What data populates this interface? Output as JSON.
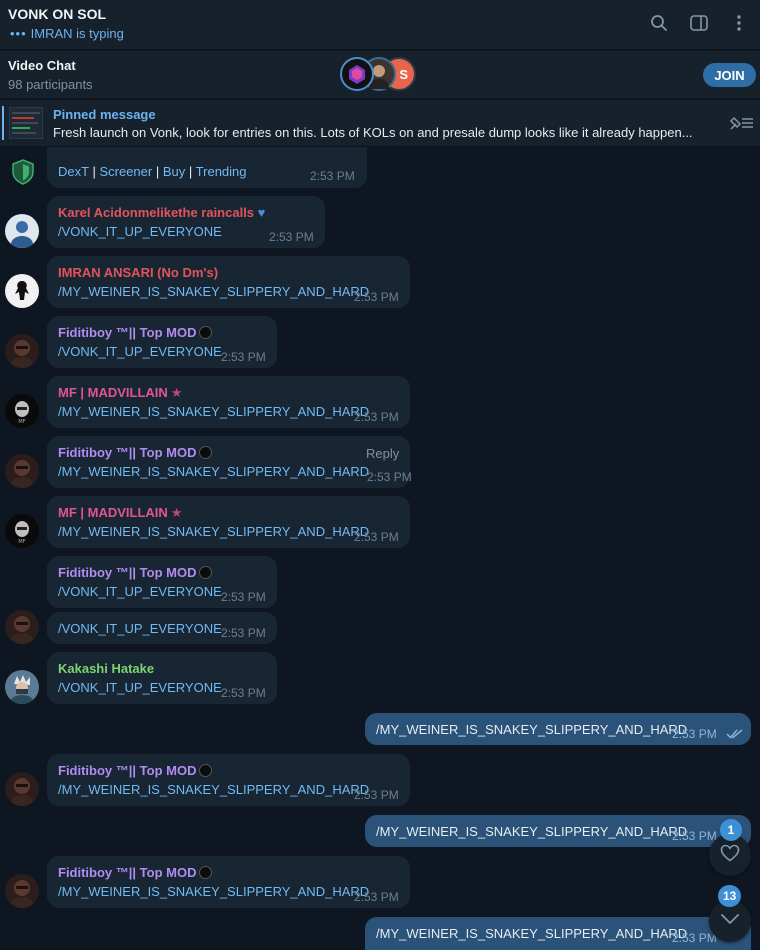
{
  "header": {
    "title": "VONK ON SOL",
    "typing": "IMRAN is typing",
    "typing_dots": "•••"
  },
  "video_chat": {
    "title": "Video Chat",
    "participants": "98 participants",
    "join_label": "JOIN",
    "third_avatar_letter": "S"
  },
  "pinned": {
    "title": "Pinned message",
    "text": "Fresh launch on Vonk, look for entries on this. Lots of KOLs on and presale dump looks like it already happen..."
  },
  "bot_links": {
    "dext": "DexT",
    "sep": "|",
    "screener": "Screener",
    "buy": "Buy",
    "trending": "Trending",
    "time": "2:53 PM"
  },
  "messages": [
    {
      "name": "Karel Acidonmelikethe raincalls",
      "text": "/VONK_IT_UP_EVERYONE",
      "time": "2:53 PM"
    },
    {
      "name": "IMRAN ANSARI (No Dm's)",
      "text": "/MY_WEINER_IS_SNAKEY_SLIPPERY_AND_HARD",
      "time": "2:53 PM"
    },
    {
      "name": "Fiditiboy ™|| Top MOD",
      "text": "/VONK_IT_UP_EVERYONE",
      "time": "2:53 PM"
    },
    {
      "name": "MF | MADVILLAIN",
      "text": "/MY_WEINER_IS_SNAKEY_SLIPPERY_AND_HARD",
      "time": "2:53 PM"
    },
    {
      "name": "Fiditiboy ™|| Top MOD",
      "text": "/MY_WEINER_IS_SNAKEY_SLIPPERY_AND_HARD",
      "time": "2:53 PM",
      "reply": "Reply"
    },
    {
      "name": "MF | MADVILLAIN",
      "text": "/MY_WEINER_IS_SNAKEY_SLIPPERY_AND_HARD",
      "time": "2:53 PM"
    },
    {
      "name": "Fiditiboy ™|| Top MOD",
      "text": "/VONK_IT_UP_EVERYONE",
      "time": "2:53 PM"
    },
    {
      "name": "",
      "text": "/VONK_IT_UP_EVERYONE",
      "time": "2:53 PM"
    },
    {
      "name": "Kakashi Hatake",
      "text": "/VONK_IT_UP_EVERYONE",
      "time": "2:53 PM"
    },
    {
      "name": "",
      "text": "/MY_WEINER_IS_SNAKEY_SLIPPERY_AND_HARD",
      "time": "2:53 PM"
    },
    {
      "name": "Fiditiboy ™|| Top MOD",
      "text": "/MY_WEINER_IS_SNAKEY_SLIPPERY_AND_HARD",
      "time": "2:53 PM"
    },
    {
      "name": "",
      "text": "/MY_WEINER_IS_SNAKEY_SLIPPERY_AND_HARD",
      "time": "2:53 PM"
    },
    {
      "name": "Fiditiboy ™|| Top MOD",
      "text": "/MY_WEINER_IS_SNAKEY_SLIPPERY_AND_HARD",
      "time": "2:53 PM"
    },
    {
      "name": "",
      "text": "/MY_WEINER_IS_SNAKEY_SLIPPERY_AND_HARD",
      "time": "2:53 PM"
    }
  ],
  "name_colors": {
    "karel": "#e2545b",
    "imran": "#e2545b",
    "fiditiboy": "#b18cf1",
    "madvillain": "#e25592",
    "kakashi": "#7cd46f"
  },
  "floating": {
    "reactions_count": "1",
    "reactions_icon": "heart-icon",
    "unread_count": "13",
    "scroll_icon": "chevron-down-icon"
  }
}
